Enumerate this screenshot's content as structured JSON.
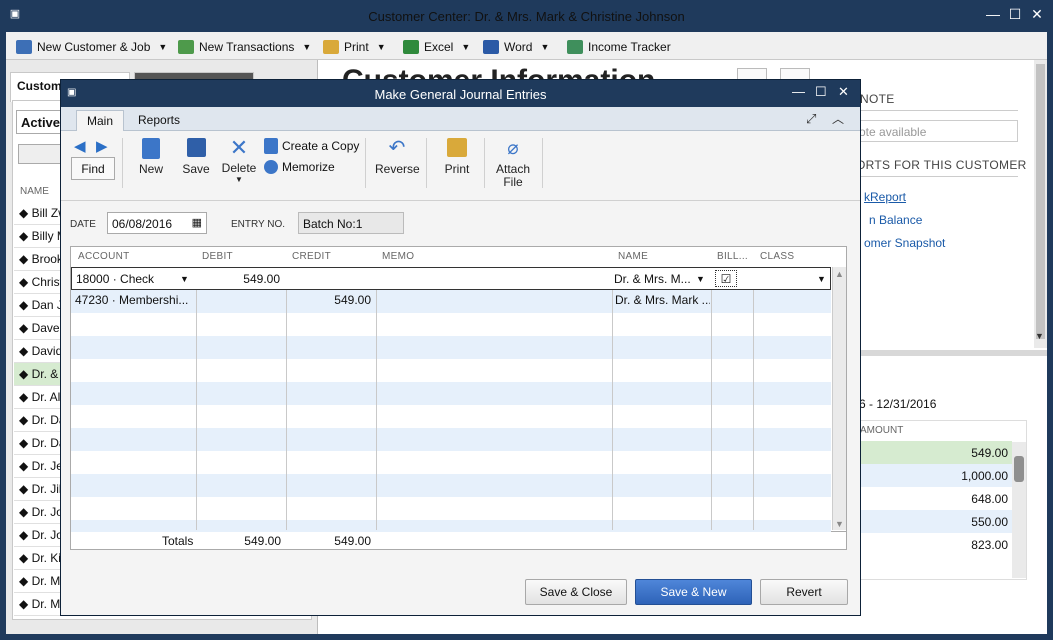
{
  "outer": {
    "title": "Customer Center: Dr. & Mrs. Mark & Christine Johnson",
    "toolbar": [
      {
        "label": "New Customer & Job",
        "icon": "new-customer-icon",
        "has_dropdown": true
      },
      {
        "label": "New Transactions",
        "icon": "new-transactions-icon",
        "has_dropdown": true
      },
      {
        "label": "Print",
        "icon": "print-icon",
        "has_dropdown": true
      },
      {
        "label": "Excel",
        "icon": "excel-icon",
        "has_dropdown": true
      },
      {
        "label": "Word",
        "icon": "word-icon",
        "has_dropdown": true
      },
      {
        "label": "Income Tracker",
        "icon": "income-tracker-icon",
        "has_dropdown": false
      }
    ]
  },
  "customer_center": {
    "tab_label": "Custom",
    "filter_value": "Active",
    "list_header": "NAME",
    "customers": [
      "Bill Zw",
      "Billy M",
      "Brook",
      "Christ",
      "Dan J",
      "Dave",
      "David",
      "Dr. & M",
      "Dr. Alli",
      "Dr. Da",
      "Dr. Da",
      "Dr. Je",
      "Dr. Jil",
      "Dr. Jo",
      "Dr. Jo",
      "Dr. Kir",
      "Dr. Ma",
      "Dr. Mic"
    ],
    "selected_index": 7,
    "right_title": "Customer Information",
    "note_heading": "NOTE",
    "note_placeholder": "ote available",
    "reports_heading": "ORTS FOR THIS CUSTOMER",
    "report_links": [
      "kReport",
      "n Balance",
      "omer Snapshot"
    ],
    "date_range": "6 - 12/31/2016",
    "amount_header": "AMOUNT",
    "amounts": [
      "549.00",
      "1,000.00",
      "648.00",
      "550.00",
      "823.00"
    ]
  },
  "dialog": {
    "title": "Make General Journal Entries",
    "tabs": [
      "Main",
      "Reports"
    ],
    "ribbon": {
      "find": "Find",
      "new": "New",
      "save": "Save",
      "delete": "Delete",
      "create_copy": "Create a Copy",
      "memorize": "Memorize",
      "reverse": "Reverse",
      "print": "Print",
      "attach_line1": "Attach",
      "attach_line2": "File"
    },
    "date_label": "DATE",
    "date_value": "06/08/2016",
    "entry_no_label": "ENTRY NO.",
    "entry_no_value": "Batch No:1",
    "columns": [
      "ACCOUNT",
      "DEBIT",
      "CREDIT",
      "MEMO",
      "NAME",
      "BILL...",
      "CLASS"
    ],
    "rows": [
      {
        "account": "18000 · Check",
        "debit": "549.00",
        "credit": "",
        "memo": "",
        "name": "Dr. & Mrs. M...",
        "billable": true,
        "class": ""
      },
      {
        "account": "47230 · Membershi...",
        "debit": "",
        "credit": "549.00",
        "memo": "",
        "name": "Dr. & Mrs. Mark ...",
        "billable": false,
        "class": ""
      }
    ],
    "totals_label": "Totals",
    "total_debit": "549.00",
    "total_credit": "549.00",
    "buttons": {
      "save_close": "Save & Close",
      "save_new": "Save & New",
      "revert": "Revert"
    }
  },
  "colors": {
    "titlebar": "#1f3a5c",
    "row_alt": "#e6f0fb",
    "selected_row": "#d6ebd0",
    "primary_button": "#2e63b8",
    "link": "#1a5aa8"
  }
}
